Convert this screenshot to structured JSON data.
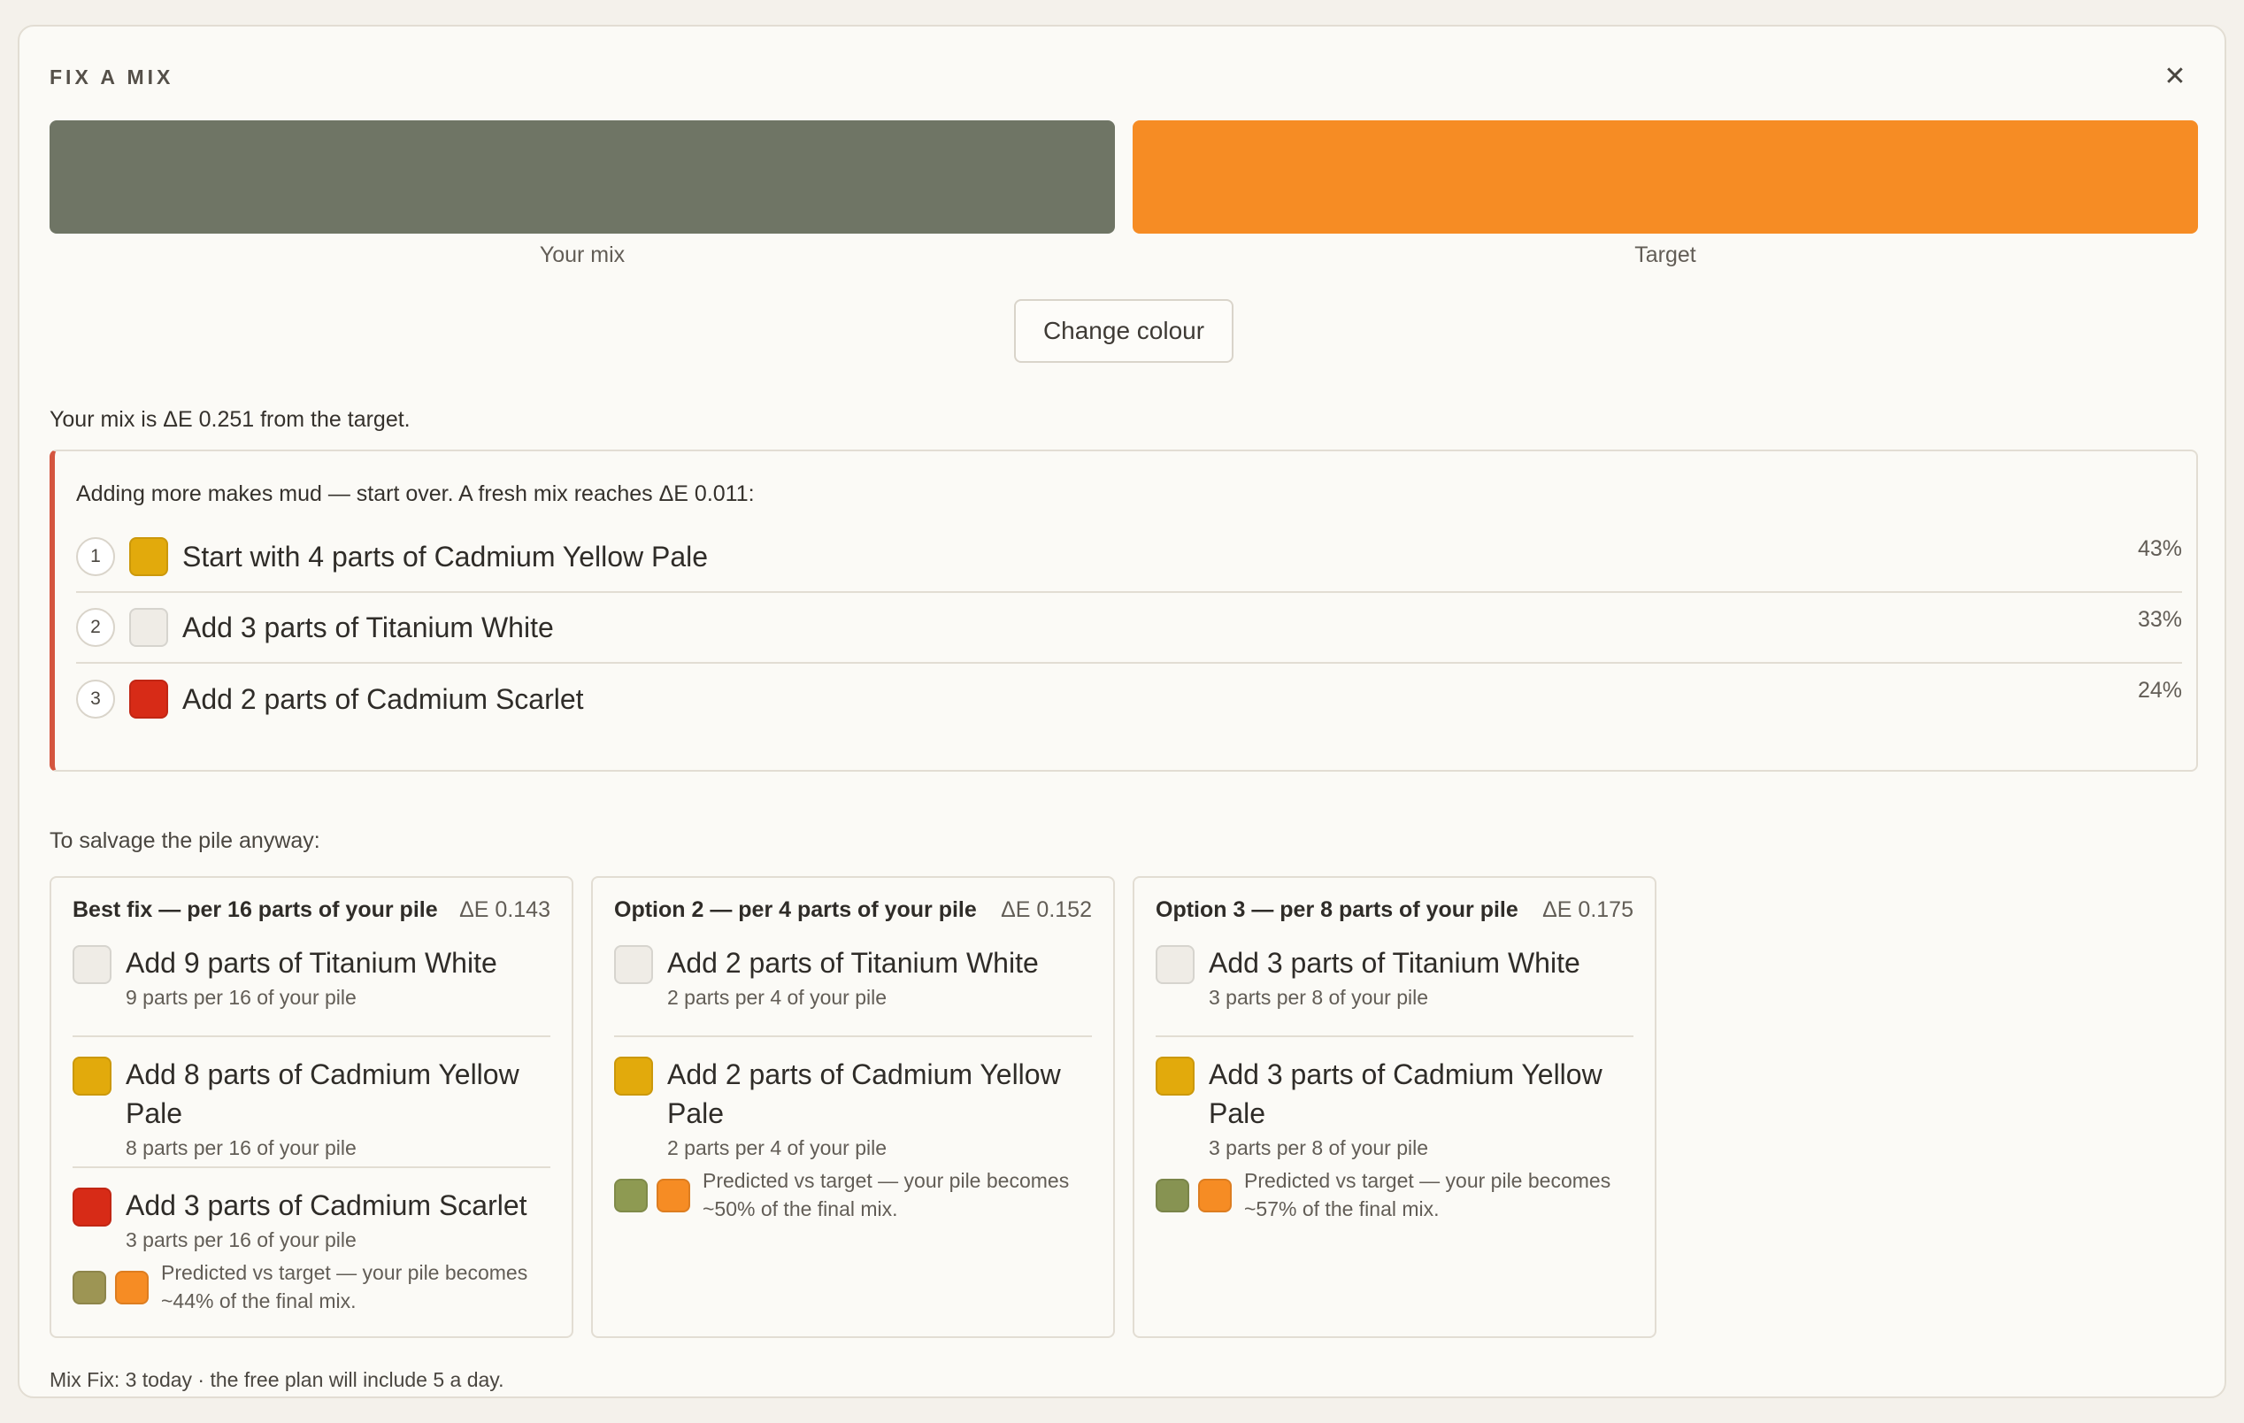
{
  "header": {
    "title": "FIX A MIX"
  },
  "swatches": {
    "your_mix": {
      "label": "Your mix",
      "color": "#6f7565"
    },
    "target": {
      "label": "Target",
      "color": "#f68c24"
    }
  },
  "change_button": "Change colour",
  "delta_text": "Your mix is ΔE 0.251 from the target.",
  "restart": {
    "heading": "Adding more makes mud — start over. A fresh mix reaches ΔE 0.011:",
    "accent_color": "#d4553f",
    "steps": [
      {
        "num": "1",
        "text": "Start with 4 parts of Cadmium Yellow Pale",
        "pct": "43%",
        "color": "#e2aa0c"
      },
      {
        "num": "2",
        "text": "Add 3 parts of Titanium White",
        "pct": "33%",
        "color": "#efece6"
      },
      {
        "num": "3",
        "text": "Add 2 parts of Cadmium Scarlet",
        "pct": "24%",
        "color": "#d72b17"
      }
    ]
  },
  "salvage_heading": "To salvage the pile anyway:",
  "options": [
    {
      "title": "Best fix — per 16 parts of your pile",
      "delta": "ΔE 0.143",
      "ingredients": [
        {
          "title": "Add 9 parts of Titanium White",
          "sub": "9 parts per 16 of your pile",
          "color": "#efece6"
        },
        {
          "title": "Add 8 parts of Cadmium Yellow Pale",
          "sub": "8 parts per 16 of your pile",
          "color": "#e2aa0c"
        },
        {
          "title": "Add 3 parts of Cadmium Scarlet",
          "sub": "3 parts per 16 of your pile",
          "color": "#d72b17"
        }
      ],
      "predicted": {
        "text": "Predicted vs target — your pile becomes ~44% of the final mix.",
        "color": "#9d9554",
        "target_color": "#f68c24"
      }
    },
    {
      "title": "Option 2 — per 4 parts of your pile",
      "delta": "ΔE 0.152",
      "ingredients": [
        {
          "title": "Add 2 parts of Titanium White",
          "sub": "2 parts per 4 of your pile",
          "color": "#efece6"
        },
        {
          "title": "Add 2 parts of Cadmium Yellow Pale",
          "sub": "2 parts per 4 of your pile",
          "color": "#e2aa0c"
        }
      ],
      "predicted": {
        "text": "Predicted vs target — your pile becomes ~50% of the final mix.",
        "color": "#8e9a52",
        "target_color": "#f68c24"
      }
    },
    {
      "title": "Option 3 — per 8 parts of your pile",
      "delta": "ΔE 0.175",
      "ingredients": [
        {
          "title": "Add 3 parts of Titanium White",
          "sub": "3 parts per 8 of your pile",
          "color": "#efece6"
        },
        {
          "title": "Add 3 parts of Cadmium Yellow Pale",
          "sub": "3 parts per 8 of your pile",
          "color": "#e2aa0c"
        }
      ],
      "predicted": {
        "text": "Predicted vs target — your pile becomes ~57% of the final mix.",
        "color": "#879352",
        "target_color": "#f68c24"
      }
    }
  ],
  "footer": "Mix Fix: 3 today · the free plan will include 5 a day."
}
